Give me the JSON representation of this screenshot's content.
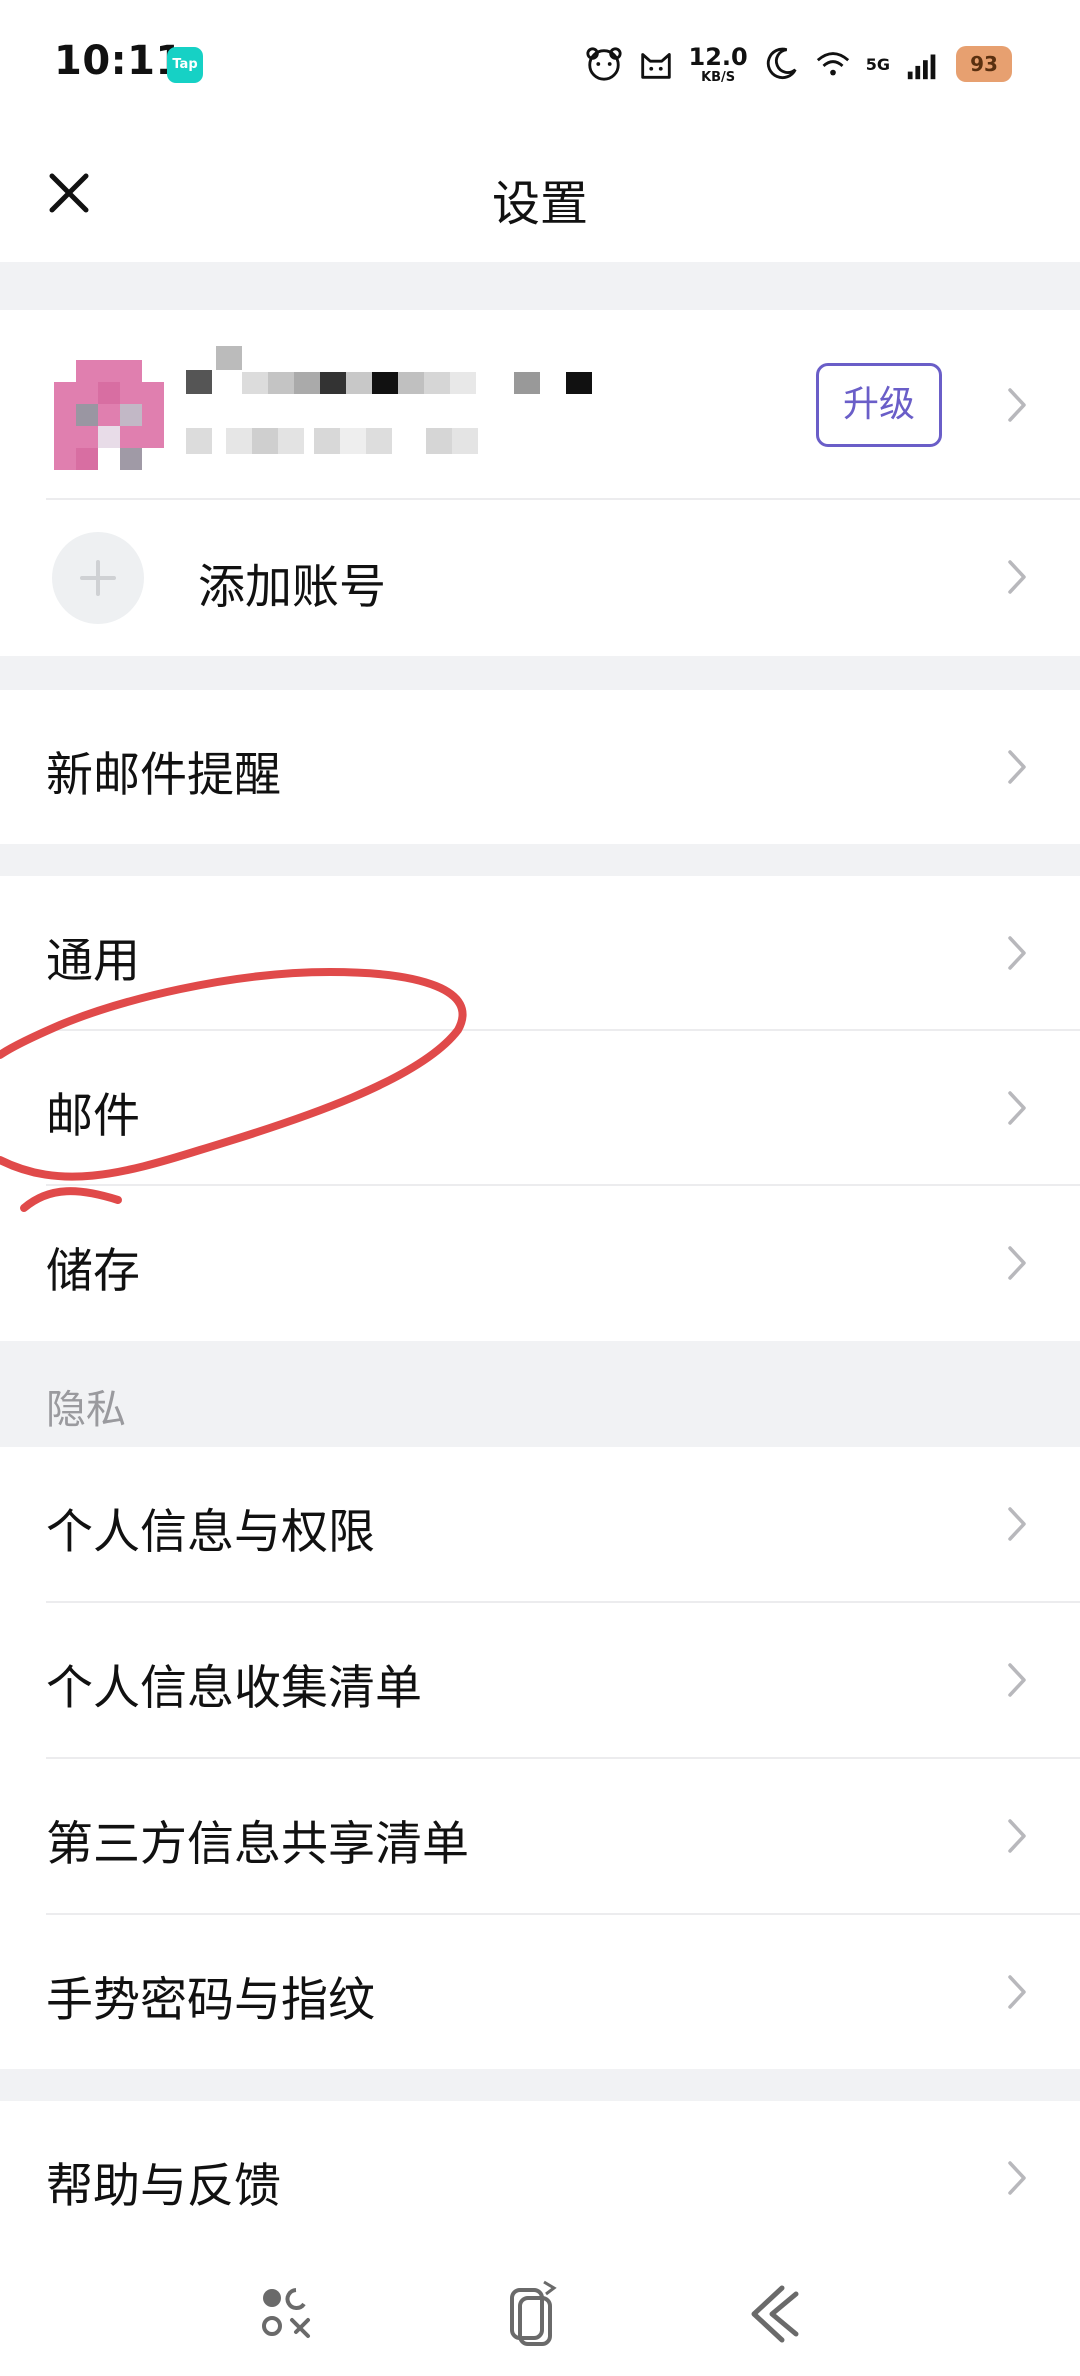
{
  "status_bar": {
    "time": "10:11",
    "tap_badge": "Tap",
    "speed_value": "12.0",
    "speed_unit": "KB/S",
    "network": "5G",
    "battery": "93"
  },
  "header": {
    "title": "设置"
  },
  "account": {
    "upgrade_label": "升级",
    "add_account_label": "添加账号"
  },
  "sections": {
    "notifications": "新邮件提醒",
    "general": "通用",
    "mail": "邮件",
    "storage": "储存",
    "privacy_header": "隐私",
    "privacy_permissions": "个人信息与权限",
    "info_collection": "个人信息收集清单",
    "third_party": "第三方信息共享清单",
    "gesture_password": "手势密码与指纹",
    "help": "帮助与反馈"
  },
  "colors": {
    "accent": "#6a5ec8",
    "annotation": "#e04a4a",
    "section_bg": "#f1f2f4"
  }
}
